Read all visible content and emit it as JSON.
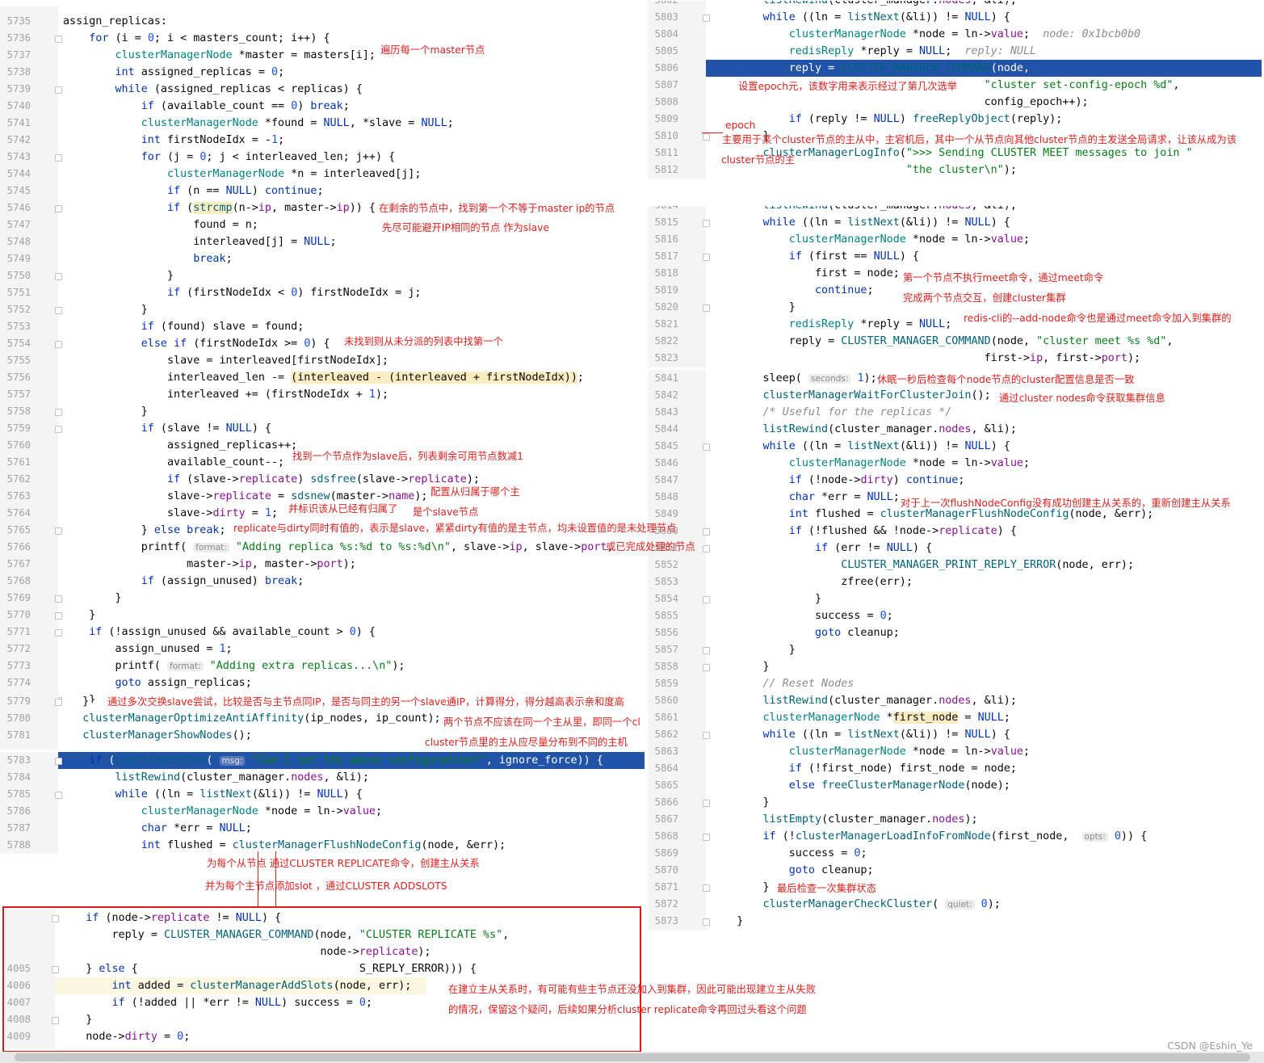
{
  "left_top": {
    "lines": [
      {
        "n": "5735",
        "c": "<span>assign_replicas:</span>"
      },
      {
        "n": "5736",
        "c": "    <span class=\"kw\">for</span> (i = <span class=\"nu\">0</span>; i < masters_count; i++) {"
      },
      {
        "n": "5737",
        "c": "        <span class=\"ty\">clusterManagerNode</span> *master = masters[i];"
      },
      {
        "n": "5738",
        "c": "        <span class=\"kw\">int</span> assigned_replicas = <span class=\"nu\">0</span>;"
      },
      {
        "n": "5739",
        "c": "        <span class=\"kw\">while</span> (assigned_replicas < replicas) {"
      },
      {
        "n": "5740",
        "c": "            <span class=\"kw\">if</span> (available_count == <span class=\"nu\">0</span>) <span class=\"kw\">break</span>;"
      },
      {
        "n": "5741",
        "c": "            <span class=\"ty\">clusterManagerNode</span> *found = <span class=\"kw\">NULL</span>, *slave = <span class=\"kw\">NULL</span>;"
      },
      {
        "n": "5742",
        "c": "            <span class=\"kw\">int</span> firstNodeIdx = -<span class=\"nu\">1</span>;"
      },
      {
        "n": "5743",
        "c": "            <span class=\"kw\">for</span> (j = <span class=\"nu\">0</span>; j < interleaved_len; j++) {"
      },
      {
        "n": "5744",
        "c": "                <span class=\"ty\">clusterManagerNode</span> *n = interleaved[j];"
      },
      {
        "n": "5745",
        "c": "                <span class=\"kw\">if</span> (n == <span class=\"kw\">NULL</span>) <span class=\"kw\">continue</span>;"
      },
      {
        "n": "5746",
        "c": "                <span class=\"kw\">if</span> (<span class=\"mark\"><span class=\"fn\">strcmp</span></span>(n-><span class=\"mc\">ip</span>, master-><span class=\"mc\">ip</span>)) {"
      },
      {
        "n": "5747",
        "c": "                    found = n;"
      },
      {
        "n": "5748",
        "c": "                    interleaved[j] = <span class=\"kw\">NULL</span>;"
      },
      {
        "n": "5749",
        "c": "                    <span class=\"kw\">break</span>;"
      },
      {
        "n": "5750",
        "c": "                }"
      },
      {
        "n": "5751",
        "c": "                <span class=\"kw\">if</span> (firstNodeIdx < <span class=\"nu\">0</span>) firstNodeIdx = j;"
      },
      {
        "n": "5752",
        "c": "            }"
      },
      {
        "n": "5753",
        "c": "            <span class=\"kw\">if</span> (found) slave = found;"
      },
      {
        "n": "5754",
        "c": "            <span class=\"kw\">else if</span> (firstNodeIdx >= <span class=\"nu\">0</span>) {"
      },
      {
        "n": "5755",
        "c": "                slave = interleaved[firstNodeIdx];"
      },
      {
        "n": "5756",
        "c": "                interleaved_len -= <span class=\"mark\">(interleaved - (interleaved + firstNodeIdx))</span>;"
      },
      {
        "n": "5757",
        "c": "                interleaved += (firstNodeIdx + <span class=\"nu\">1</span>);"
      },
      {
        "n": "5758",
        "c": "            }"
      },
      {
        "n": "5759",
        "c": "            <span class=\"kw\">if</span> (slave != <span class=\"kw\">NULL</span>) {"
      },
      {
        "n": "5760",
        "c": "                assigned_replicas++;"
      },
      {
        "n": "5761",
        "c": "                available_count--;"
      },
      {
        "n": "5762",
        "c": "                <span class=\"kw\">if</span> (slave-><span class=\"mc\">replicate</span>) <span class=\"fn\">sdsfree</span>(slave-><span class=\"mc\">replicate</span>);"
      },
      {
        "n": "5763",
        "c": "                slave-><span class=\"mc\">replicate</span> = <span class=\"fn\">sdsnew</span>(master-><span class=\"mc\">name</span>);"
      },
      {
        "n": "5764",
        "c": "                slave-><span class=\"mc\">dirty</span> = <span class=\"nu\">1</span>;"
      },
      {
        "n": "5765",
        "c": "            } <span class=\"kw\">else break</span>;"
      },
      {
        "n": "5766",
        "c": "            printf( <span class=\"hint\">format:</span> <span class=\"st\">\"Adding replica %s:%d to %s:%d\\n\"</span>, slave-><span class=\"mc\">ip</span>, slave-><span class=\"mc\">port</span>,"
      },
      {
        "n": "5767",
        "c": "                   master-><span class=\"mc\">ip</span>, master-><span class=\"mc\">port</span>);"
      },
      {
        "n": "5768",
        "c": "            <span class=\"kw\">if</span> (assign_unused) <span class=\"kw\">break</span>;"
      },
      {
        "n": "5769",
        "c": "        }"
      },
      {
        "n": "5770",
        "c": "    }"
      },
      {
        "n": "5771",
        "c": "    <span class=\"kw\">if</span> (!assign_unused && available_count > <span class=\"nu\">0</span>) {"
      },
      {
        "n": "5772",
        "c": "        assign_unused = <span class=\"nu\">1</span>;"
      },
      {
        "n": "5773",
        "c": "        printf( <span class=\"hint\">format:</span> <span class=\"st\">\"Adding extra replicas...\\n\"</span>);"
      },
      {
        "n": "5774",
        "c": "        <span class=\"kw\">goto</span> assign_replicas;"
      },
      {
        "n": "5775",
        "c": "    }"
      }
    ]
  },
  "left_mid": {
    "lines": [
      {
        "n": "5779",
        "c": "   }"
      },
      {
        "n": "5780",
        "c": "   <span class=\"fn\">clusterManagerOptimizeAntiAffinity</span>(ip_nodes, ip_count);"
      },
      {
        "n": "5781",
        "c": "   <span class=\"fn\">clusterManagerShowNodes</span>();"
      }
    ]
  },
  "left_bottom": {
    "lines": [
      {
        "n": "5783",
        "c": "    <span class=\"kw\">if</span> (<span class=\"fn\">confirmWithYes</span>( <span class=\"hint\">msg:</span> <span class=\"st\">\"Can I set the above configuration?\"</span>, ignore_force)) {",
        "hl": true
      },
      {
        "n": "5784",
        "c": "        <span class=\"fn\">listRewind</span>(cluster_manager.<span class=\"mc\">nodes</span>, &li);"
      },
      {
        "n": "5785",
        "c": "        <span class=\"kw\">while</span> ((ln = <span class=\"fn\">listNext</span>(&li)) != <span class=\"kw\">NULL</span>) {"
      },
      {
        "n": "5786",
        "c": "            <span class=\"ty\">clusterManagerNode</span> *node = ln-><span class=\"mc\">value</span>;"
      },
      {
        "n": "5787",
        "c": "            <span class=\"kw\">char</span> *err = <span class=\"kw\">NULL</span>;"
      },
      {
        "n": "5788",
        "c": "            <span class=\"kw\">int</span> flushed = <span class=\"fn\">clusterManagerFlushNodeConfig</span>(node, &err);"
      }
    ]
  },
  "box": {
    "lines": [
      {
        "n": "",
        "c": "    <span class=\"kw\">if</span> (node-><span class=\"mc\">replicate</span> != <span class=\"kw\">NULL</span>) {"
      },
      {
        "n": "",
        "c": "        reply = <span class=\"fn\">CLUSTER_MANAGER_COMMAND</span>(node, <span class=\"st\">\"CLUSTER REPLICATE %s\"</span>,"
      },
      {
        "n": "",
        "c": "                                        node-><span class=\"mc\">replicate</span>);"
      },
      {
        "n": "4005",
        "c": "    } <span class=\"kw\">else</span> {                                  <span>S_REPLY_ERROR))) {</span>"
      },
      {
        "n": "4006",
        "c": "        <span class=\"kw\">int</span> added = <span class=\"fn\">clusterManagerAddSlots</span>(node, err);",
        "soft": true
      },
      {
        "n": "4007",
        "c": "        <span class=\"kw\">if</span> (!added || *err != <span class=\"kw\">NULL</span>) success = <span class=\"nu\">0</span>;"
      },
      {
        "n": "4008",
        "c": "    }"
      },
      {
        "n": "4009",
        "c": "    node-><span class=\"mc\">dirty</span> = <span class=\"nu\">0</span>;"
      }
    ]
  },
  "right_top": {
    "lines": [
      {
        "n": "5802",
        "c": "        <span class=\"fn\">listRewind</span>(cluster_manager.<span class=\"mc\">nodes</span>, &li);"
      },
      {
        "n": "5803",
        "c": "        <span class=\"kw\">while</span> ((ln = <span class=\"fn\">listNext</span>(&li)) != <span class=\"kw\">NULL</span>) {"
      },
      {
        "n": "5804",
        "c": "            <span class=\"ty\">clusterManagerNode</span> *node = ln-><span class=\"mc\">value</span>;  <span class=\"inl\">node: 0x1bcb0b0</span>"
      },
      {
        "n": "5805",
        "c": "            <span class=\"ty\">redisReply</span> *reply = <span class=\"kw\">NULL</span>;  <span class=\"inl\">reply: NULL</span>"
      },
      {
        "n": "5806",
        "c": "            reply = <span class=\"fn\">CLUSTER_MANAGER_COMMAND</span>(node,",
        "hl": true
      },
      {
        "n": "5807",
        "c": "                                          <span class=\"st\">\"cluster set-config-epoch %d\"</span>,"
      },
      {
        "n": "5808",
        "c": "                                          config_epoch++);"
      },
      {
        "n": "5809",
        "c": "            <span class=\"kw\">if</span> (reply != <span class=\"kw\">NULL</span>) <span class=\"fn\">freeReplyObject</span>(reply);"
      },
      {
        "n": "5810",
        "c": "        }"
      },
      {
        "n": "5811",
        "c": "        <span class=\"fn\">clusterManagerLogInfo</span>(<span class=\"st\">\">>> Sending CLUSTER MEET messages to join \"</span>"
      },
      {
        "n": "5812",
        "c": "                              <span class=\"st\">\"the cluster\\n\"</span>);"
      }
    ]
  },
  "right_mid": {
    "lines": [
      {
        "n": "5814",
        "c": "        <span class=\"fn\">listRewind</span>(cluster_manager.<span class=\"mc\">nodes</span>, &li);"
      },
      {
        "n": "5815",
        "c": "        <span class=\"kw\">while</span> ((ln = <span class=\"fn\">listNext</span>(&li)) != <span class=\"kw\">NULL</span>) {"
      },
      {
        "n": "5816",
        "c": "            <span class=\"ty\">clusterManagerNode</span> *node = ln-><span class=\"mc\">value</span>;"
      },
      {
        "n": "5817",
        "c": "            <span class=\"kw\">if</span> (first == <span class=\"kw\">NULL</span>) {"
      },
      {
        "n": "5818",
        "c": "                first = node;"
      },
      {
        "n": "5819",
        "c": "                <span class=\"kw\">continue</span>;"
      },
      {
        "n": "5820",
        "c": "            }"
      },
      {
        "n": "5821",
        "c": "            <span class=\"ty\">redisReply</span> *reply = <span class=\"kw\">NULL</span>;"
      },
      {
        "n": "5822",
        "c": "            reply = <span class=\"fn\">CLUSTER_MANAGER_COMMAND</span>(node, <span class=\"st\">\"cluster meet %s %d\"</span>,"
      },
      {
        "n": "5823",
        "c": "                                          first-><span class=\"mc\">ip</span>, first-><span class=\"mc\">port</span>);"
      }
    ]
  },
  "right_bottom": {
    "lines": [
      {
        "n": "5841",
        "c": "        sleep( <span class=\"hint\">seconds:</span> <span class=\"nu\">1</span>);"
      },
      {
        "n": "5842",
        "c": "        <span class=\"fn\">clusterManagerWaitForClusterJoin</span>();"
      },
      {
        "n": "5843",
        "c": "        <span class=\"cm\">/* Useful for the replicas */</span>"
      },
      {
        "n": "5844",
        "c": "        <span class=\"fn\">listRewind</span>(cluster_manager.<span class=\"mc\">nodes</span>, &li);"
      },
      {
        "n": "5845",
        "c": "        <span class=\"kw\">while</span> ((ln = <span class=\"fn\">listNext</span>(&li)) != <span class=\"kw\">NULL</span>) {"
      },
      {
        "n": "5846",
        "c": "            <span class=\"ty\">clusterManagerNode</span> *node = ln-><span class=\"mc\">value</span>;"
      },
      {
        "n": "5847",
        "c": "            <span class=\"kw\">if</span> (!node-><span class=\"mc\">dirty</span>) <span class=\"kw\">continue</span>;"
      },
      {
        "n": "5848",
        "c": "            <span class=\"kw\">char</span> *err = <span class=\"kw\">NULL</span>;"
      },
      {
        "n": "5849",
        "c": "            <span class=\"kw\">int</span> flushed = <span class=\"fn\">clusterManagerFlushNodeConfig</span>(node, &err);"
      },
      {
        "n": "5850",
        "c": "            <span class=\"kw\">if</span> (!flushed && !node-><span class=\"mc\">replicate</span>) {"
      },
      {
        "n": "5851",
        "c": "                <span class=\"kw\">if</span> (err != <span class=\"kw\">NULL</span>) {"
      },
      {
        "n": "5852",
        "c": "                    <span class=\"fn\">CLUSTER_MANAGER_PRINT_REPLY_ERROR</span>(node, err);"
      },
      {
        "n": "5853",
        "c": "                    zfree(err);"
      },
      {
        "n": "5854",
        "c": "                }"
      },
      {
        "n": "5855",
        "c": "                success = <span class=\"nu\">0</span>;"
      },
      {
        "n": "5856",
        "c": "                <span class=\"kw\">goto</span> cleanup;"
      },
      {
        "n": "5857",
        "c": "            }"
      },
      {
        "n": "5858",
        "c": "        }"
      },
      {
        "n": "5859",
        "c": "        <span class=\"cm\">// Reset Nodes</span>"
      },
      {
        "n": "5860",
        "c": "        <span class=\"fn\">listRewind</span>(cluster_manager.<span class=\"mc\">nodes</span>, &li);"
      },
      {
        "n": "5861",
        "c": "        <span class=\"ty\">clusterManagerNode</span> *<span class=\"mark\">first_node</span> = <span class=\"kw\">NULL</span>;"
      },
      {
        "n": "5862",
        "c": "        <span class=\"kw\">while</span> ((ln = <span class=\"fn\">listNext</span>(&li)) != <span class=\"kw\">NULL</span>) {"
      },
      {
        "n": "5863",
        "c": "            <span class=\"ty\">clusterManagerNode</span> *node = ln-><span class=\"mc\">value</span>;"
      },
      {
        "n": "5864",
        "c": "            <span class=\"kw\">if</span> (!first_node) first_node = node;"
      },
      {
        "n": "5865",
        "c": "            <span class=\"kw\">else</span> <span class=\"fn\">freeClusterManagerNode</span>(node);"
      },
      {
        "n": "5866",
        "c": "        }"
      },
      {
        "n": "5867",
        "c": "        <span class=\"fn\">listEmpty</span>(cluster_manager.<span class=\"mc\">nodes</span>);"
      },
      {
        "n": "5868",
        "c": "        <span class=\"kw\">if</span> (!<span class=\"fn\">clusterManagerLoadInfoFromNode</span>(first_node,  <span class=\"hint\">opts:</span> <span class=\"nu\">0</span>)) {"
      },
      {
        "n": "5869",
        "c": "            success = <span class=\"nu\">0</span>;"
      },
      {
        "n": "5870",
        "c": "            <span class=\"kw\">goto</span> cleanup;"
      },
      {
        "n": "5871",
        "c": "        }"
      },
      {
        "n": "5872",
        "c": "        <span class=\"fn\">clusterManagerCheckCluster</span>( <span class=\"hint\">quiet:</span> <span class=\"nu\">0</span>);"
      },
      {
        "n": "5873",
        "c": "    }"
      }
    ]
  },
  "annotations": {
    "a1": "遍历每一个master节点",
    "a2": "在剩余的节点中，找到第一个不等于master ip的节点",
    "a3": "先尽可能避开IP相同的节点 作为slave",
    "a4": "未找到则从未分派的列表中找第一个",
    "a5": "找到一个节点作为slave后，列表剩余可用节点数减1",
    "a6": "配置从归属于哪个主",
    "a7": "并标识该从已经有归属了",
    "a8": "是个slave节点",
    "a9": "replicate与dirty同时有值的，表示是slave，紧紧dirty有值的是主节点，均未设置值的是未处理节点",
    "a10": "或已完成处理的节点",
    "a11": "通过多次交换slave尝试，比较是否与主节点同IP，是否与同主的另一个slave通IP，计算得分，得分越高表示亲和度高",
    "a12": "两个节点不应该在同一个主从里，即同一个cl",
    "a13": "cluster节点里的主从应尽量分布到不同的主机",
    "a14": "为每个从节点 通过CLUSTER REPLICATE命令，创建主从关系",
    "a15": "并为每个主节点添加slot ，通过CLUSTER ADDSLOTS",
    "a16": "在建立主从关系时，有可能有些主节点还没加入到集群，因此可能出现建立主从失败",
    "a17": "的情况，保留这个疑问，后续如果分析cluster replicate命令再回过头看这个问题",
    "a18": "设置epoch元，该数字用来表示经过了第几次选举",
    "a19": "epoch",
    "a20": "主要用于某个cluster节点的主从中，主宕机后，其中一个从节点向其他cluster节点的主发送全局请求，让该从成为该",
    "a21": "cluster节点的主",
    "a22": "第一个节点不执行meet命令，通过meet命令",
    "a23": "完成两个节点交互，创建cluster集群",
    "a24": "redis-cli的--add-node命令也是通过meet命令加入到集群的",
    "a25": "休眠一秒后检查每个node节点的cluster配置信息是否一致",
    "a26": "通过cluster nodes命令获取集群信息",
    "a27": "对于上一次flushNodeConfig没有成功创建主从关系的，重新创建主从关系",
    "a28": "最后检查一次集群状态"
  },
  "watermark": "CSDN @Eshin_Ye"
}
